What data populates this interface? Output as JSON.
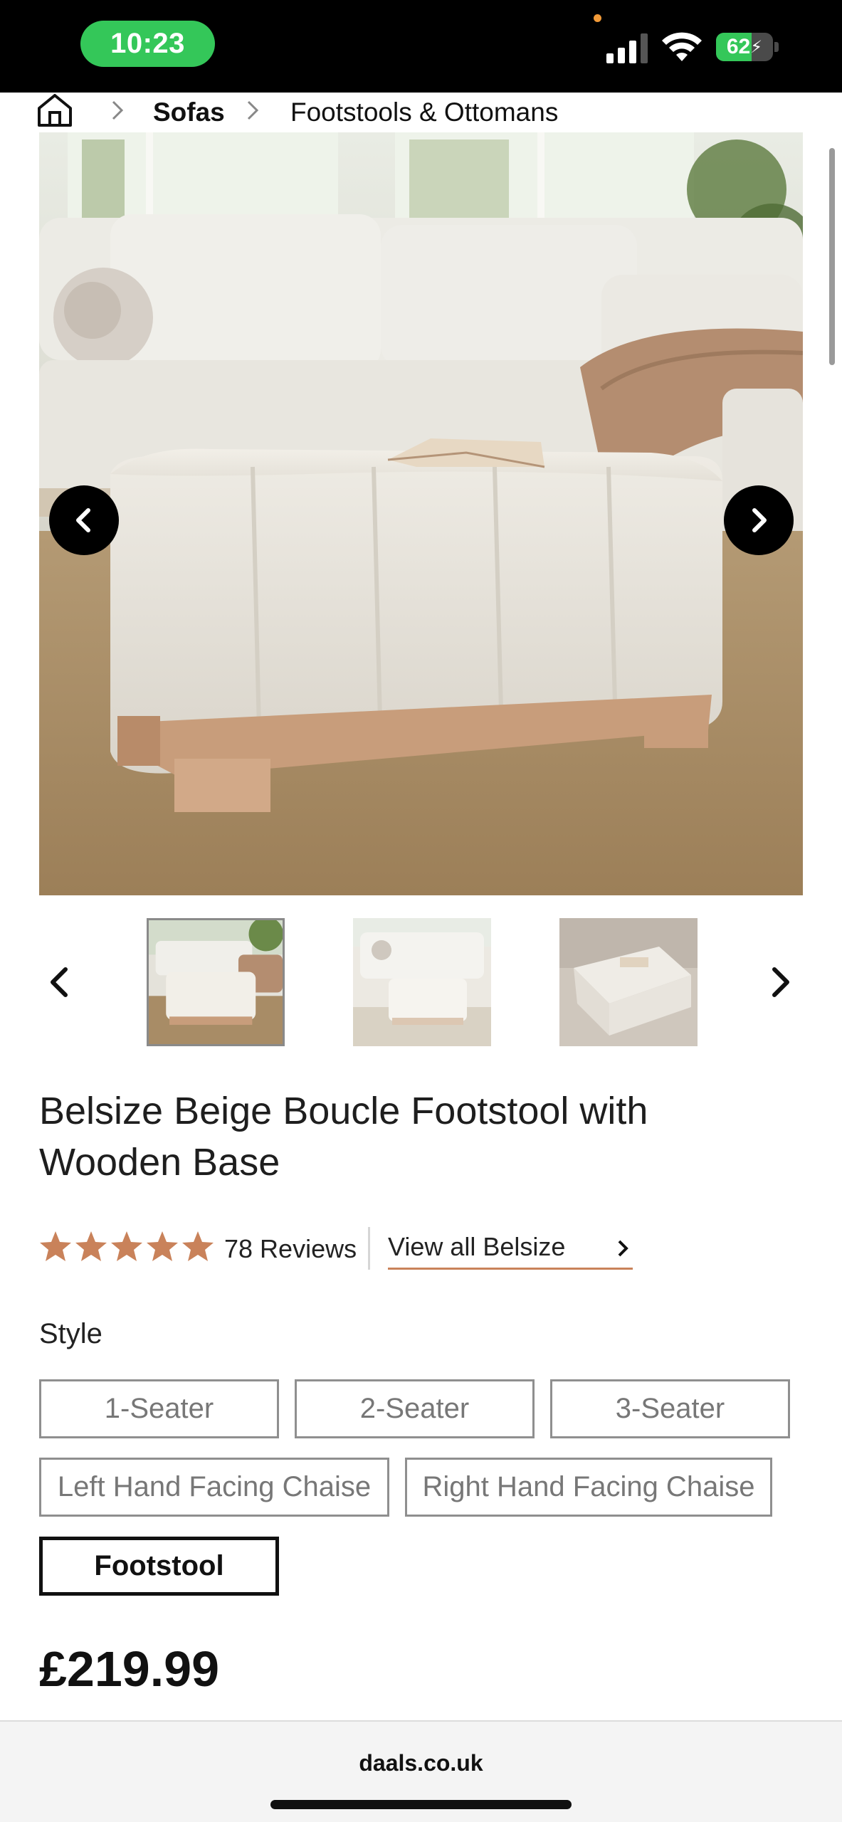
{
  "status_bar": {
    "time": "10:23",
    "battery_level": "62",
    "battery_fraction": 0.62,
    "colors": {
      "time_pill": "#34c759",
      "battery": "#34c759",
      "privacy_dot": "#f29a38"
    },
    "icons": [
      "signal-icon",
      "wifi-icon",
      "battery-charging-icon"
    ]
  },
  "breadcrumb": {
    "icons": [
      "home-icon",
      "chevron-right-icon"
    ],
    "items": [
      "Sofas",
      "Footstools & Ottomans"
    ]
  },
  "gallery": {
    "icons": [
      "chevron-left-icon",
      "chevron-right-icon"
    ],
    "thumbnail_count": 3,
    "active_thumbnail": 1
  },
  "product": {
    "title": "Belsize Beige Boucle Footstool with Wooden Base",
    "rating": 5,
    "rating_max": 5,
    "reviews": "78 Reviews",
    "view_all": "View all Belsize",
    "star_color": "#c9825a",
    "price": "£219.99"
  },
  "style_selector": {
    "label": "Style",
    "options": [
      "1-Seater",
      "2-Seater",
      "3-Seater",
      "Left Hand Facing Chaise",
      "Right Hand Facing Chaise",
      "Footstool"
    ],
    "selected": "Footstool"
  },
  "browser": {
    "url": "daals.co.uk"
  }
}
